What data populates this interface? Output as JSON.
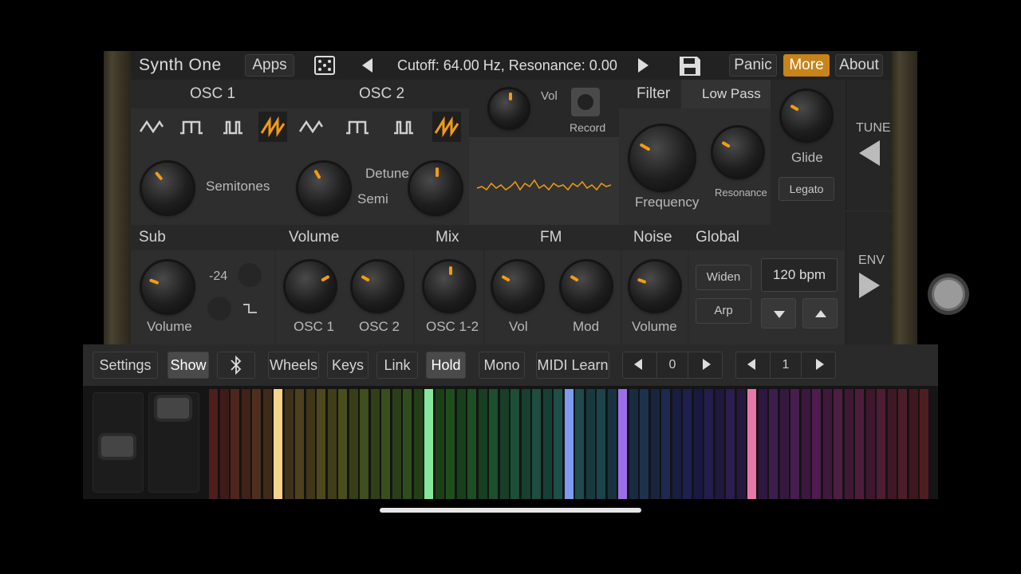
{
  "app": {
    "name": "Synth One"
  },
  "topbar": {
    "apps_label": "Apps",
    "preset_name": "Cutoff: 64.00 Hz, Resonance: 0.00",
    "panic_label": "Panic",
    "more_label": "More",
    "about_label": "About",
    "icons": [
      "dice-icon",
      "prev-preset-icon",
      "next-preset-icon",
      "save-icon"
    ]
  },
  "osc1": {
    "title": "OSC 1",
    "semitones_label": "Semitones",
    "selected_wave": "sawtooth"
  },
  "osc2": {
    "title": "OSC 2",
    "detune_label": "Detune",
    "semi_label": "Semi",
    "selected_wave": "sawtooth"
  },
  "recorder": {
    "vol_label": "Vol",
    "record_label": "Record"
  },
  "filter": {
    "title": "Filter",
    "type": "Low Pass",
    "frequency_label": "Frequency",
    "resonance_label": "Resonance"
  },
  "glide": {
    "label": "Glide",
    "legato_label": "Legato"
  },
  "side_nav": {
    "tune_label": "TUNE",
    "env_label": "ENV"
  },
  "sub": {
    "title": "Sub",
    "volume_label": "Volume",
    "octave_value": "-24"
  },
  "volume": {
    "title": "Volume",
    "osc1_label": "OSC 1",
    "osc2_label": "OSC 2"
  },
  "mix": {
    "title": "Mix",
    "osc12_label": "OSC 1-2"
  },
  "fm": {
    "title": "FM",
    "vol_label": "Vol",
    "mod_label": "Mod"
  },
  "noise": {
    "title": "Noise",
    "volume_label": "Volume"
  },
  "global": {
    "title": "Global",
    "widen_label": "Widen",
    "arp_label": "Arp",
    "bpm": "120 bpm"
  },
  "bottombar": {
    "settings_label": "Settings",
    "show_label": "Show",
    "wheels_label": "Wheels",
    "keys_label": "Keys",
    "link_label": "Link",
    "hold_label": "Hold",
    "mono_label": "Mono",
    "midi_learn_label": "MIDI Learn",
    "octave_value": "0",
    "channel_value": "1",
    "icons": [
      "bluetooth-icon"
    ]
  },
  "keyboard": {
    "highlight_colors": [
      "#f6d38a",
      "#86e69c",
      "#7f9bf0",
      "#9b6fe8",
      "#e878a8"
    ]
  }
}
